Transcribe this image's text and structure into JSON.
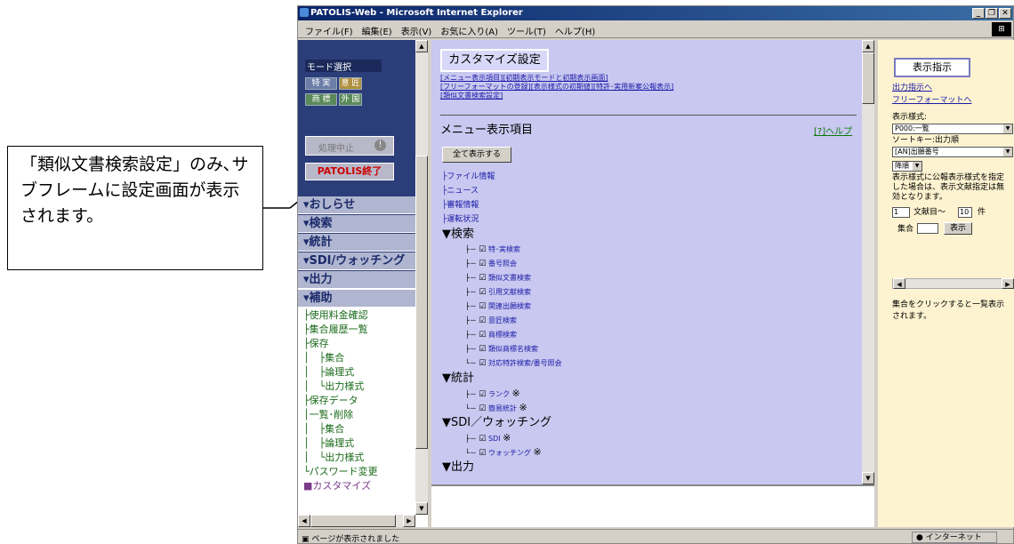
{
  "callout": {
    "text": "「類似文書検索設定」のみ､サブフレームに設定画面が表示されます。"
  },
  "window": {
    "title": "PATOLIS-Web - Microsoft Internet Explorer",
    "menu": [
      "ファイル(F)",
      "編集(E)",
      "表示(V)",
      "お気に入り(A)",
      "ツール(T)",
      "ヘルプ(H)"
    ]
  },
  "left": {
    "mode_label": "モード選択",
    "modes": [
      "特 実",
      "意 匠",
      "商 標",
      "外 国"
    ],
    "stop_button": "処理中止",
    "exit_button": "PATOLIS終了",
    "sections": [
      "▾おしらせ",
      "▾検索",
      "▾統計",
      "▾SDI/ウォッチング",
      "▾出力",
      "▾補助"
    ],
    "sub_items": [
      "├使用料金確認",
      "├集合履歴一覧",
      "├保存",
      "│　├集合",
      "│　├論理式",
      "│　└出力様式",
      "├保存データ",
      "│一覧･削除",
      "│　├集合",
      "│　├論理式",
      "│　└出力様式",
      "└パスワード変更"
    ],
    "customize": "■カスタマイズ"
  },
  "main": {
    "customize_title": "カスタマイズ設定",
    "links": [
      "[メニュー表示項目][初期表示モードと初期表示画面]",
      "[フリーフォーマットの登録][表示様式の初期値][特許･実用新案公報表示]",
      "[類似文書検索設定]"
    ],
    "menu_title": "メニュー表示項目",
    "help": "[?]ヘルプ",
    "show_all": "全て表示する",
    "info_items": [
      "├ファイル情報",
      "├ニュース",
      "├審報情報",
      "├運転状況"
    ],
    "search_head": "▼検索",
    "search_items": [
      "特･実検索",
      "番号照会",
      "類似文書検索",
      "引用文献検索",
      "関連出願検索",
      "意匠検索",
      "商標検索",
      "類似商標名検索",
      "対応特許検索/番号照会"
    ],
    "stats_head": "▼統計",
    "stats_items": [
      "ランク",
      "簡易統計"
    ],
    "sdi_head": "▼SDI／ウォッチング",
    "sdi_items": [
      "SDI",
      "ウォッチング"
    ],
    "output_head": "▼出力",
    "mark": "※",
    "check": "☑"
  },
  "right": {
    "display_button": "表示指示",
    "output_link": "出力指示へ",
    "free_link": "フリーフォーマットへ",
    "style_label": "表示様式:",
    "style_value": "P000:一覧",
    "sort_label": "ソートキー:出力順",
    "sort_value": "[AN]出願番号",
    "order_value": "降順",
    "note": "表示様式に公報表示様式を指定した場合は、表示文献指定は無効となります。",
    "from_value": "1",
    "from_label": "文献目～",
    "to_value": "10",
    "to_label": "件",
    "set_label": "集合",
    "show_button": "表示",
    "bottom_note": "集合をクリックすると一覧表示されます。"
  },
  "status": {
    "text": "ページが表示されました",
    "zone": "インターネット"
  }
}
